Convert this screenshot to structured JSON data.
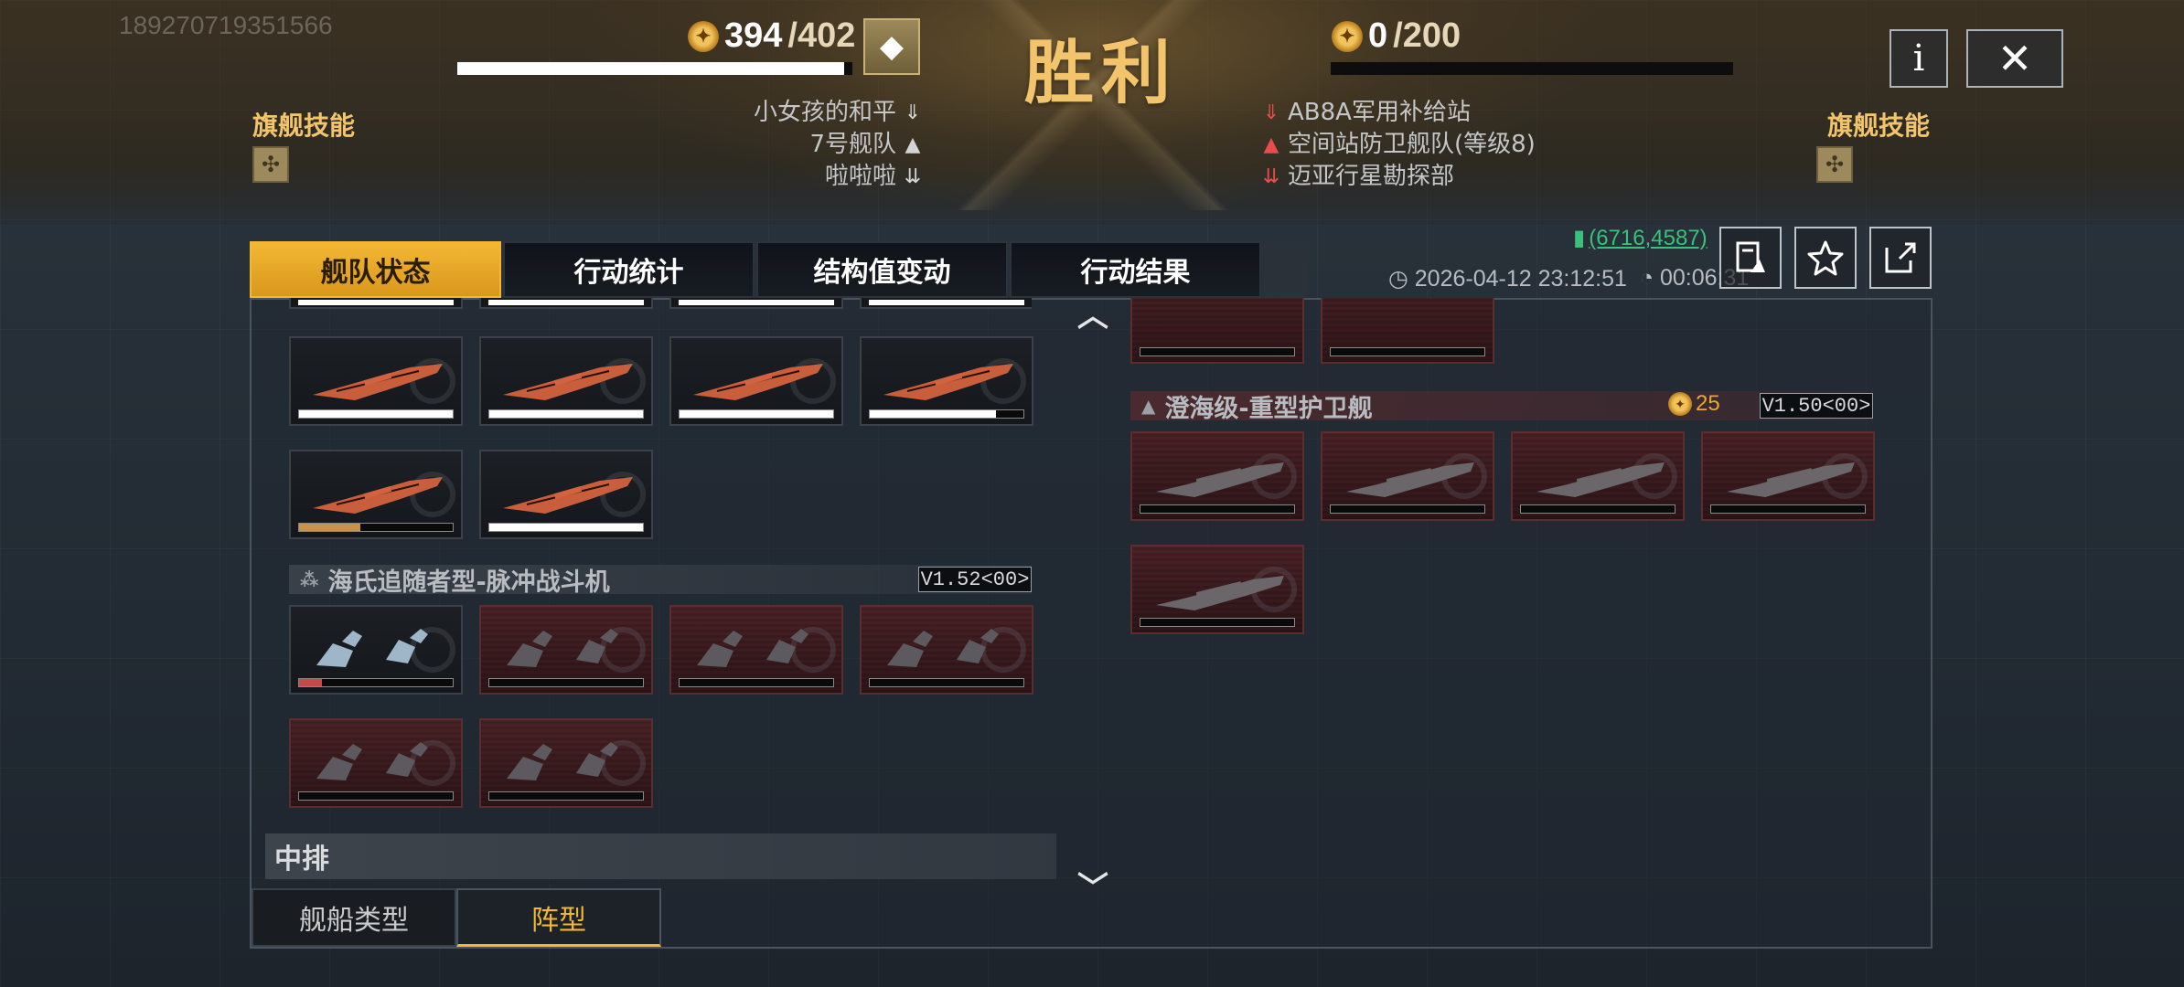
{
  "watermark": "189270719351566",
  "header": {
    "title": "胜利",
    "left_score": {
      "current": "394",
      "max": "/402",
      "fill_fraction": 0.98
    },
    "right_score": {
      "current": "0",
      "max": "/200",
      "fill_fraction": 0.0
    },
    "info_label": "i",
    "close_label": "✕"
  },
  "flagship": {
    "left_label": "旗舰技能",
    "right_label": "旗舰技能"
  },
  "left_fleets": [
    {
      "name": "小女孩的和平",
      "marker": "⇓"
    },
    {
      "name": "7号舰队",
      "marker": "▲"
    },
    {
      "name": "啦啦啦",
      "marker": "⇊"
    }
  ],
  "right_fleets": [
    {
      "name": "AB8A军用补给站",
      "marker": "⇓"
    },
    {
      "name": "空间站防卫舰队(等级8)",
      "marker": "▲"
    },
    {
      "name": "迈亚行星勘探部",
      "marker": "⇊"
    }
  ],
  "tabs": [
    {
      "label": "舰队状态",
      "active": true
    },
    {
      "label": "行动统计",
      "active": false
    },
    {
      "label": "结构值变动",
      "active": false
    },
    {
      "label": "行动结果",
      "active": false
    }
  ],
  "location": "(6716,4587)",
  "timestamp": "2026-04-12 23:12:51",
  "duration": "00:06:31",
  "left_column": {
    "ship_group_1": {
      "hp_fractions": [
        1.0,
        1.0,
        1.0,
        0.82,
        0.4,
        1.0
      ]
    },
    "section_2": {
      "title": "海氏追随者型-脉冲战斗机",
      "version": "V1.52<00>",
      "hp_fractions": [
        0.15,
        0,
        0,
        0,
        0,
        0
      ]
    }
  },
  "right_column": {
    "section_1": {
      "title": "澄海级-重型护卫舰",
      "cost": "25",
      "version": "V1.50<00>"
    }
  },
  "row_label": "中排",
  "bottom_tabs": [
    {
      "label": "舰船类型",
      "active": false
    },
    {
      "label": "阵型",
      "active": true
    }
  ],
  "colors": {
    "accent": "#f3b734",
    "victory": "#f2c56c",
    "location": "#38c27a",
    "enemy_marker": "#e84c4c"
  }
}
